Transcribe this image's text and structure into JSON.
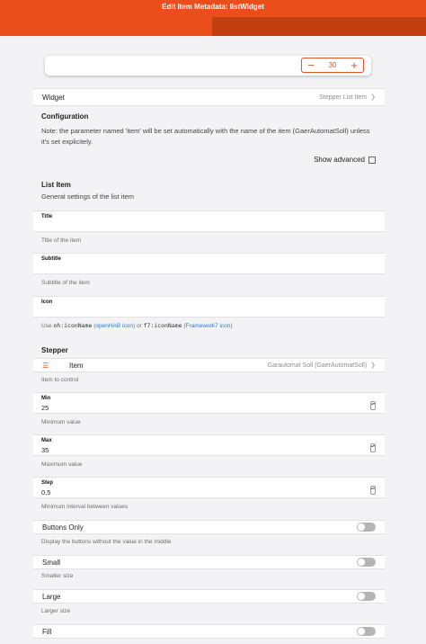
{
  "header": {
    "title": "Edit Item Metadata: listWidget"
  },
  "preview": {
    "stepper_value": "30",
    "minus": "−",
    "plus": "+"
  },
  "widget": {
    "label": "Widget",
    "value": "Stepper List Item"
  },
  "configuration": {
    "heading": "Configuration",
    "note": "Note: the parameter named 'item' will be set automatically with the name of the item (GaerAutomatSoll) unless it's set explicitely.",
    "show_advanced": "Show advanced"
  },
  "list_item": {
    "heading": "List Item",
    "description": "General settings of the list item",
    "title": {
      "label": "Title",
      "value": "",
      "hint": "Title of the item"
    },
    "subtitle": {
      "label": "Subtitle",
      "value": "",
      "hint": "Subtitle of the item"
    },
    "icon": {
      "label": "Icon",
      "value": "",
      "hint_use": "Use",
      "hint_oh": "oh:iconName",
      "hint_openhab": "(openHAB icon)",
      "hint_or": "or",
      "hint_f7": "f7:iconName",
      "hint_f7link": "(Framework7 icon)"
    }
  },
  "stepper": {
    "heading": "Stepper",
    "item": {
      "label": "Item",
      "value": "Garautomat Soll (GaerAutomatSoll)",
      "hint": "Item to control"
    },
    "min": {
      "label": "Min",
      "value": "25",
      "hint": "Minimum value"
    },
    "max": {
      "label": "Max",
      "value": "35",
      "hint": "Maximum value"
    },
    "step": {
      "label": "Step",
      "value": "0,5",
      "hint": "Minimum interval between values"
    },
    "buttons_only": {
      "label": "Buttons Only",
      "hint": "Display the buttons without the value in the middle",
      "on": false
    },
    "small": {
      "label": "Small",
      "hint": "Smaller size",
      "on": false
    },
    "large": {
      "label": "Large",
      "hint": "Larger size",
      "on": false
    },
    "fill": {
      "label": "Fill",
      "on": false
    }
  },
  "colors": {
    "accent": "#ea4f1b",
    "accent_dark": "#c2400f",
    "link": "#2a7ad4"
  },
  "icons": {
    "item_icon": "list-icon",
    "chevron": "chevron-right-icon"
  }
}
